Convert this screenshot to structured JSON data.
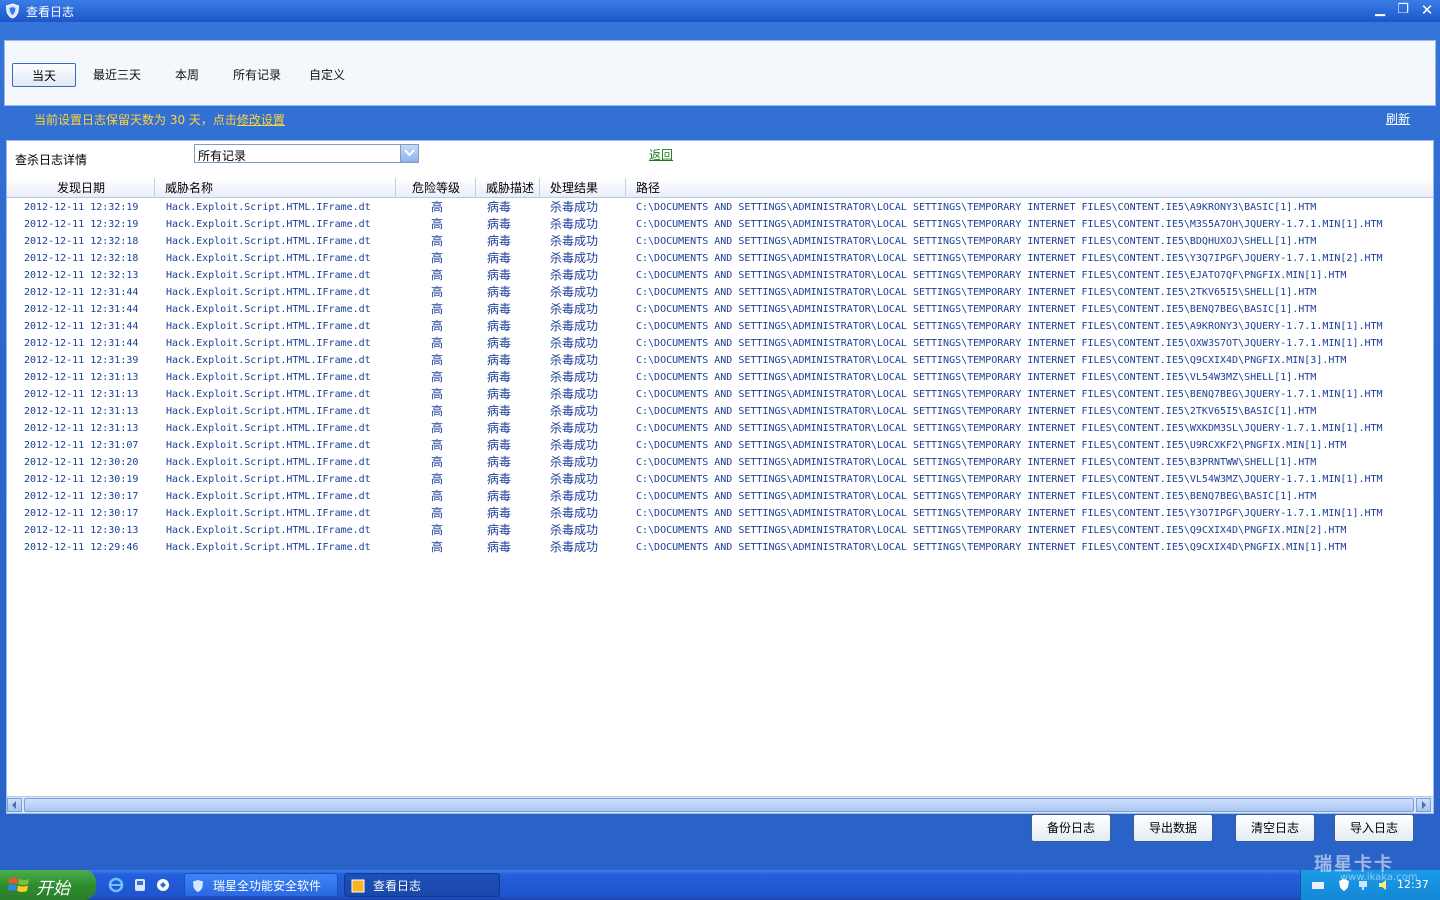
{
  "window": {
    "title": "查看日志"
  },
  "filters": [
    {
      "label": "当天",
      "active": true
    },
    {
      "label": "最近三天",
      "active": false
    },
    {
      "label": "本周",
      "active": false
    },
    {
      "label": "所有记录",
      "active": false
    },
    {
      "label": "自定义",
      "active": false
    }
  ],
  "notice": {
    "prefix": "当前设置日志保留天数为 30 天，点击",
    "link": "修改设置"
  },
  "refresh_label": "刷新",
  "detail": {
    "label": "查杀日志详情",
    "select_value": "所有记录",
    "back_label": "返回"
  },
  "columns": [
    "发现日期",
    "威胁名称",
    "危险等级",
    "威胁描述",
    "处理结果",
    "路径"
  ],
  "rows": [
    [
      "2012-12-11 12:32:19",
      "Hack.Exploit.Script.HTML.IFrame.dt",
      "高",
      "病毒",
      "杀毒成功",
      "C:\\DOCUMENTS AND SETTINGS\\ADMINISTRATOR\\LOCAL SETTINGS\\TEMPORARY INTERNET FILES\\CONTENT.IE5\\A9KRONY3\\BASIC[1].HTM"
    ],
    [
      "2012-12-11 12:32:19",
      "Hack.Exploit.Script.HTML.IFrame.dt",
      "高",
      "病毒",
      "杀毒成功",
      "C:\\DOCUMENTS AND SETTINGS\\ADMINISTRATOR\\LOCAL SETTINGS\\TEMPORARY INTERNET FILES\\CONTENT.IE5\\M3S5A7OH\\JQUERY-1.7.1.MIN[1].HTM"
    ],
    [
      "2012-12-11 12:32:18",
      "Hack.Exploit.Script.HTML.IFrame.dt",
      "高",
      "病毒",
      "杀毒成功",
      "C:\\DOCUMENTS AND SETTINGS\\ADMINISTRATOR\\LOCAL SETTINGS\\TEMPORARY INTERNET FILES\\CONTENT.IE5\\BDQHUXOJ\\SHELL[1].HTM"
    ],
    [
      "2012-12-11 12:32:18",
      "Hack.Exploit.Script.HTML.IFrame.dt",
      "高",
      "病毒",
      "杀毒成功",
      "C:\\DOCUMENTS AND SETTINGS\\ADMINISTRATOR\\LOCAL SETTINGS\\TEMPORARY INTERNET FILES\\CONTENT.IE5\\Y3Q7IPGF\\JQUERY-1.7.1.MIN[2].HTM"
    ],
    [
      "2012-12-11 12:32:13",
      "Hack.Exploit.Script.HTML.IFrame.dt",
      "高",
      "病毒",
      "杀毒成功",
      "C:\\DOCUMENTS AND SETTINGS\\ADMINISTRATOR\\LOCAL SETTINGS\\TEMPORARY INTERNET FILES\\CONTENT.IE5\\EJATO7QF\\PNGFIX.MIN[1].HTM"
    ],
    [
      "2012-12-11 12:31:44",
      "Hack.Exploit.Script.HTML.IFrame.dt",
      "高",
      "病毒",
      "杀毒成功",
      "C:\\DOCUMENTS AND SETTINGS\\ADMINISTRATOR\\LOCAL SETTINGS\\TEMPORARY INTERNET FILES\\CONTENT.IE5\\2TKV65I5\\SHELL[1].HTM"
    ],
    [
      "2012-12-11 12:31:44",
      "Hack.Exploit.Script.HTML.IFrame.dt",
      "高",
      "病毒",
      "杀毒成功",
      "C:\\DOCUMENTS AND SETTINGS\\ADMINISTRATOR\\LOCAL SETTINGS\\TEMPORARY INTERNET FILES\\CONTENT.IE5\\BENQ7BEG\\BASIC[1].HTM"
    ],
    [
      "2012-12-11 12:31:44",
      "Hack.Exploit.Script.HTML.IFrame.dt",
      "高",
      "病毒",
      "杀毒成功",
      "C:\\DOCUMENTS AND SETTINGS\\ADMINISTRATOR\\LOCAL SETTINGS\\TEMPORARY INTERNET FILES\\CONTENT.IE5\\A9KRONY3\\JQUERY-1.7.1.MIN[1].HTM"
    ],
    [
      "2012-12-11 12:31:44",
      "Hack.Exploit.Script.HTML.IFrame.dt",
      "高",
      "病毒",
      "杀毒成功",
      "C:\\DOCUMENTS AND SETTINGS\\ADMINISTRATOR\\LOCAL SETTINGS\\TEMPORARY INTERNET FILES\\CONTENT.IE5\\OXW3S7OT\\JQUERY-1.7.1.MIN[1].HTM"
    ],
    [
      "2012-12-11 12:31:39",
      "Hack.Exploit.Script.HTML.IFrame.dt",
      "高",
      "病毒",
      "杀毒成功",
      "C:\\DOCUMENTS AND SETTINGS\\ADMINISTRATOR\\LOCAL SETTINGS\\TEMPORARY INTERNET FILES\\CONTENT.IE5\\Q9CXIX4D\\PNGFIX.MIN[3].HTM"
    ],
    [
      "2012-12-11 12:31:13",
      "Hack.Exploit.Script.HTML.IFrame.dt",
      "高",
      "病毒",
      "杀毒成功",
      "C:\\DOCUMENTS AND SETTINGS\\ADMINISTRATOR\\LOCAL SETTINGS\\TEMPORARY INTERNET FILES\\CONTENT.IE5\\VL54W3MZ\\SHELL[1].HTM"
    ],
    [
      "2012-12-11 12:31:13",
      "Hack.Exploit.Script.HTML.IFrame.dt",
      "高",
      "病毒",
      "杀毒成功",
      "C:\\DOCUMENTS AND SETTINGS\\ADMINISTRATOR\\LOCAL SETTINGS\\TEMPORARY INTERNET FILES\\CONTENT.IE5\\BENQ7BEG\\JQUERY-1.7.1.MIN[1].HTM"
    ],
    [
      "2012-12-11 12:31:13",
      "Hack.Exploit.Script.HTML.IFrame.dt",
      "高",
      "病毒",
      "杀毒成功",
      "C:\\DOCUMENTS AND SETTINGS\\ADMINISTRATOR\\LOCAL SETTINGS\\TEMPORARY INTERNET FILES\\CONTENT.IE5\\2TKV65I5\\BASIC[1].HTM"
    ],
    [
      "2012-12-11 12:31:13",
      "Hack.Exploit.Script.HTML.IFrame.dt",
      "高",
      "病毒",
      "杀毒成功",
      "C:\\DOCUMENTS AND SETTINGS\\ADMINISTRATOR\\LOCAL SETTINGS\\TEMPORARY INTERNET FILES\\CONTENT.IE5\\WXKDM3SL\\JQUERY-1.7.1.MIN[1].HTM"
    ],
    [
      "2012-12-11 12:31:07",
      "Hack.Exploit.Script.HTML.IFrame.dt",
      "高",
      "病毒",
      "杀毒成功",
      "C:\\DOCUMENTS AND SETTINGS\\ADMINISTRATOR\\LOCAL SETTINGS\\TEMPORARY INTERNET FILES\\CONTENT.IE5\\U9RCXKF2\\PNGFIX.MIN[1].HTM"
    ],
    [
      "2012-12-11 12:30:20",
      "Hack.Exploit.Script.HTML.IFrame.dt",
      "高",
      "病毒",
      "杀毒成功",
      "C:\\DOCUMENTS AND SETTINGS\\ADMINISTRATOR\\LOCAL SETTINGS\\TEMPORARY INTERNET FILES\\CONTENT.IE5\\B3PRNTWW\\SHELL[1].HTM"
    ],
    [
      "2012-12-11 12:30:19",
      "Hack.Exploit.Script.HTML.IFrame.dt",
      "高",
      "病毒",
      "杀毒成功",
      "C:\\DOCUMENTS AND SETTINGS\\ADMINISTRATOR\\LOCAL SETTINGS\\TEMPORARY INTERNET FILES\\CONTENT.IE5\\VL54W3MZ\\JQUERY-1.7.1.MIN[1].HTM"
    ],
    [
      "2012-12-11 12:30:17",
      "Hack.Exploit.Script.HTML.IFrame.dt",
      "高",
      "病毒",
      "杀毒成功",
      "C:\\DOCUMENTS AND SETTINGS\\ADMINISTRATOR\\LOCAL SETTINGS\\TEMPORARY INTERNET FILES\\CONTENT.IE5\\BENQ7BEG\\BASIC[1].HTM"
    ],
    [
      "2012-12-11 12:30:17",
      "Hack.Exploit.Script.HTML.IFrame.dt",
      "高",
      "病毒",
      "杀毒成功",
      "C:\\DOCUMENTS AND SETTINGS\\ADMINISTRATOR\\LOCAL SETTINGS\\TEMPORARY INTERNET FILES\\CONTENT.IE5\\Y3O7IPGF\\JQUERY-1.7.1.MIN[1].HTM"
    ],
    [
      "2012-12-11 12:30:13",
      "Hack.Exploit.Script.HTML.IFrame.dt",
      "高",
      "病毒",
      "杀毒成功",
      "C:\\DOCUMENTS AND SETTINGS\\ADMINISTRATOR\\LOCAL SETTINGS\\TEMPORARY INTERNET FILES\\CONTENT.IE5\\Q9CXIX4D\\PNGFIX.MIN[2].HTM"
    ],
    [
      "2012-12-11 12:29:46",
      "Hack.Exploit.Script.HTML.IFrame.dt",
      "高",
      "病毒",
      "杀毒成功",
      "C:\\DOCUMENTS AND SETTINGS\\ADMINISTRATOR\\LOCAL SETTINGS\\TEMPORARY INTERNET FILES\\CONTENT.IE5\\Q9CXIX4D\\PNGFIX.MIN[1].HTM"
    ]
  ],
  "actions": {
    "backup": "备份日志",
    "export": "导出数据",
    "clear": "清空日志",
    "import": "导入日志"
  },
  "taskbar": {
    "start_label": "开始",
    "tasks": [
      "瑞星全功能安全软件",
      "查看日志"
    ],
    "clock": "12:37"
  },
  "watermark": {
    "brand": "瑞星卡卡",
    "url": "www.ikaka.com"
  },
  "colors": {
    "accent": "#2a63c8",
    "notice": "#ffd535",
    "row_text": "#1d3f9a",
    "back_link": "#1a7a1a"
  }
}
